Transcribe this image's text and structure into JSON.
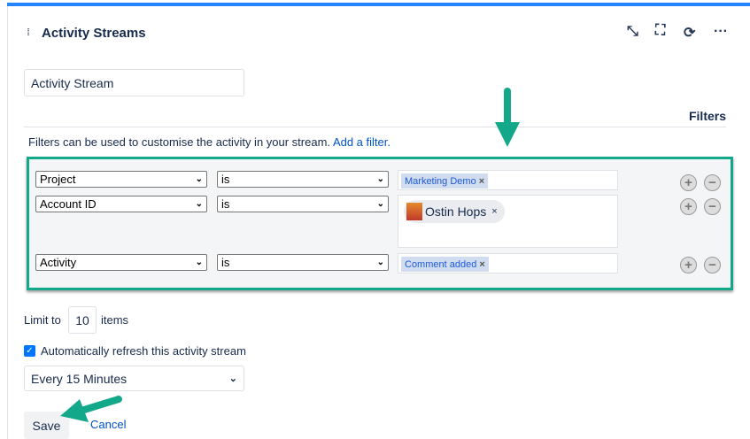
{
  "header": {
    "title": "Activity Streams",
    "icons": [
      "minimize-icon",
      "fullscreen-icon",
      "refresh-icon",
      "more-icon"
    ]
  },
  "name_input": {
    "value": "Activity Stream"
  },
  "filters": {
    "label": "Filters",
    "help": "Filters can be used to customise the activity in your stream.",
    "add_link": "Add a filter.",
    "rows": [
      {
        "field": "Project",
        "operator": "is",
        "value": "Marketing Demo"
      },
      {
        "field": "Account ID",
        "operator": "is",
        "value": "Ostin Hops"
      },
      {
        "field": "Activity",
        "operator": "is",
        "value": "Comment added"
      }
    ]
  },
  "limit": {
    "prefix": "Limit to",
    "value": "10",
    "suffix": "items"
  },
  "refresh": {
    "checked": true,
    "label": "Automatically refresh this activity stream",
    "interval": "Every 15 Minutes"
  },
  "actions": {
    "save": "Save",
    "cancel": "Cancel"
  },
  "colors": {
    "accent": "#2684ff",
    "annotation": "#14a88a",
    "link": "#0052cc"
  }
}
